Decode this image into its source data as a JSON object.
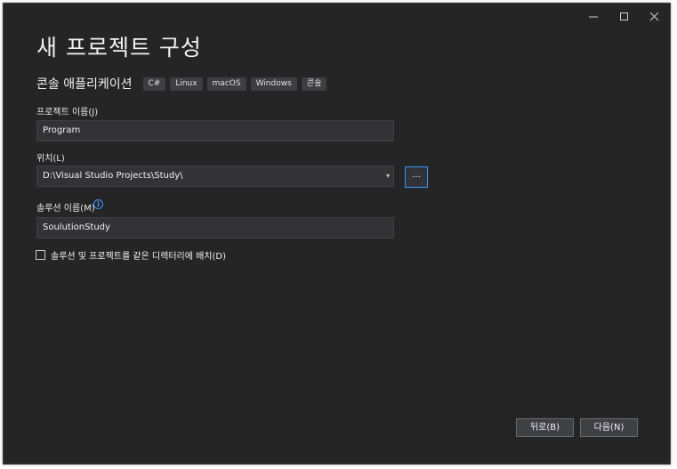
{
  "window": {
    "controls": {
      "minimize": "minimize-icon",
      "maximize": "maximize-icon",
      "close": "close-icon"
    }
  },
  "header": {
    "title": "새 프로젝트 구성",
    "template_name": "콘솔 애플리케이션",
    "tags": [
      "C#",
      "Linux",
      "macOS",
      "Windows",
      "콘솔"
    ]
  },
  "form": {
    "project_name": {
      "label": "프로젝트 이름(J)",
      "value": "Program"
    },
    "location": {
      "label": "위치(L)",
      "value": "D:\\Visual Studio Projects\\Study\\",
      "browse_label": "..."
    },
    "solution_name": {
      "label": "솔루션 이름(M)",
      "value": "SoulutionStudy",
      "info_icon": "info-icon"
    },
    "same_directory": {
      "label": "솔루션 및 프로젝트를 같은 디렉터리에 배치(D)",
      "checked": false
    }
  },
  "footer": {
    "back_label": "뒤로(B)",
    "next_label": "다음(N)"
  },
  "colors": {
    "background": "#252526",
    "input_bg": "#333337",
    "accent": "#3399ff",
    "button_bg": "#3f3f46"
  }
}
